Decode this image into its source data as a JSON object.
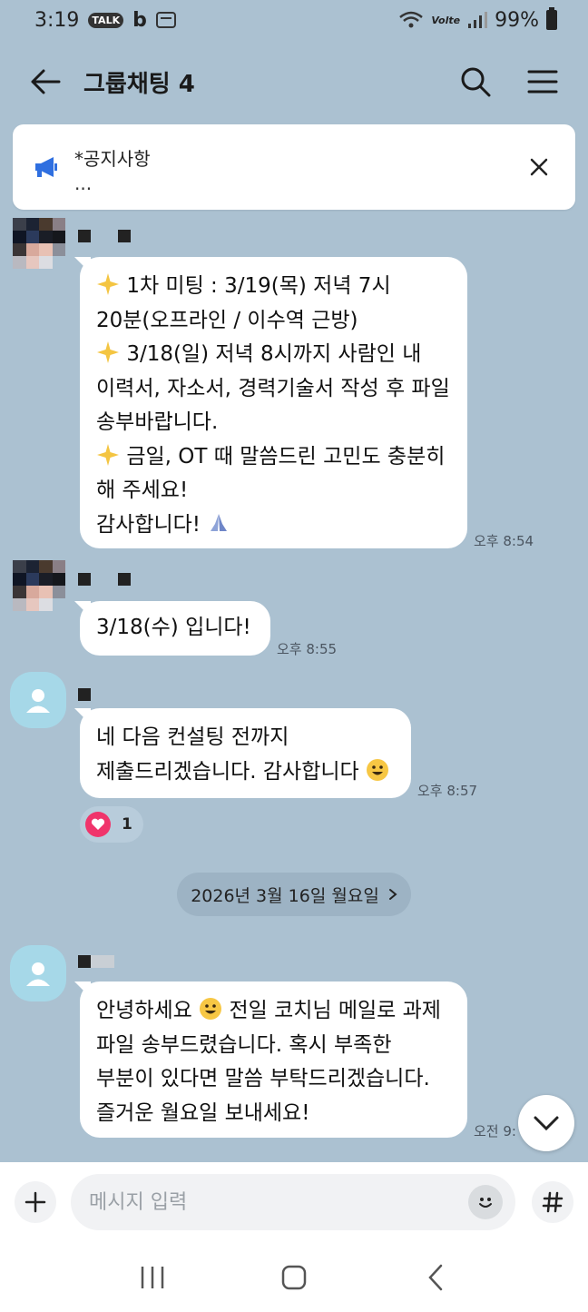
{
  "status_bar": {
    "time": "3:19",
    "talk_badge": "TALK",
    "b_badge": "b",
    "volte": "Volte",
    "battery": "99%"
  },
  "header": {
    "title": "그룹채팅 4",
    "back_icon": "arrow-left-icon",
    "search_icon": "search-icon",
    "menu_icon": "hamburger-menu-icon"
  },
  "notice": {
    "title": "*공지사항",
    "subtitle": "...",
    "icon": "megaphone-icon",
    "close_icon": "close-icon"
  },
  "messages": [
    {
      "lines": [
        "1차 미팅 : 3/19(목) 저녁 7시",
        "20분(오프라인 / 이수역 근방)",
        "3/18(일) 저녁 8시까지 사람인 내",
        "이력서, 자소서, 경력기술서 작성 후 파일",
        "송부바랍니다.",
        "금일, OT 때 말씀드린 고민도 충분히",
        "해 주세요!",
        "감사합니다!"
      ],
      "time": "오후 8:54"
    },
    {
      "lines": [
        "3/18(수) 입니다!"
      ],
      "time": "오후 8:55"
    },
    {
      "lines": [
        "네 다음 컨설팅 전까지",
        "제출드리겠습니다. 감사합니다"
      ],
      "time": "오후 8:57",
      "reaction_count": "1"
    },
    {
      "lines": [
        "안녕하세요",
        "전일 코치님 메일로 과제",
        "파일 송부드렸습니다. 혹시 부족한",
        "부분이 있다면 말씀 부탁드리겠습니다.",
        "즐거운 월요일 보내세요!"
      ],
      "time": "오전 9:"
    }
  ],
  "date_divider": "2026년 3월 16일 월요일",
  "input": {
    "placeholder": "메시지 입력"
  },
  "colors": {
    "background": "#abc1d1",
    "bubble": "#ffffff",
    "heart": "#f0346b",
    "notice_icon": "#2f6fe0"
  }
}
